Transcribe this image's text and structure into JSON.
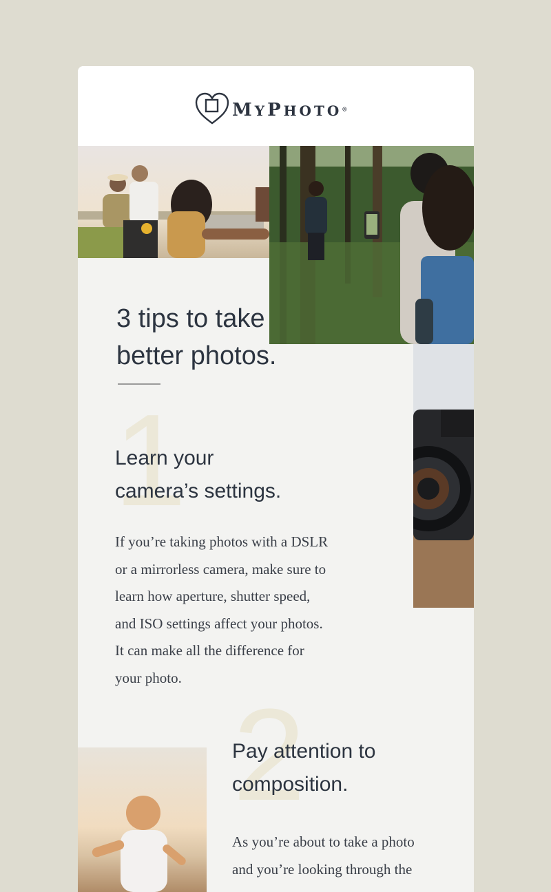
{
  "brand": {
    "name_first": "M",
    "name_rest": "Y",
    "name_second_first": "P",
    "name_second_rest": "HOTO",
    "registered": "®"
  },
  "hero_photos": [
    {
      "name": "grandparents-photo",
      "description_icon": "family-photo"
    },
    {
      "name": "forest-photo",
      "description_icon": "forest-photo"
    }
  ],
  "article": {
    "title": "3 tips to take\nbetter photos.",
    "tips": [
      {
        "number": "1",
        "heading": "Learn your\ncamera’s settings.",
        "body": "If you’re taking photos with a DSLR\nor a mirrorless camera, make sure to\nlearn how aperture, shutter speed,\nand ISO settings affect your photos.\nIt can make all the difference for\nyour photo."
      },
      {
        "number": "2",
        "heading": "Pay attention to\ncomposition.",
        "body": "As you’re about to take a photo\nand you’re looking through the"
      }
    ]
  },
  "colors": {
    "page_background": "#dedcd0",
    "card_background": "#f3f3f1",
    "text": "#2c3440",
    "number_watermark": "#ece8d8"
  }
}
